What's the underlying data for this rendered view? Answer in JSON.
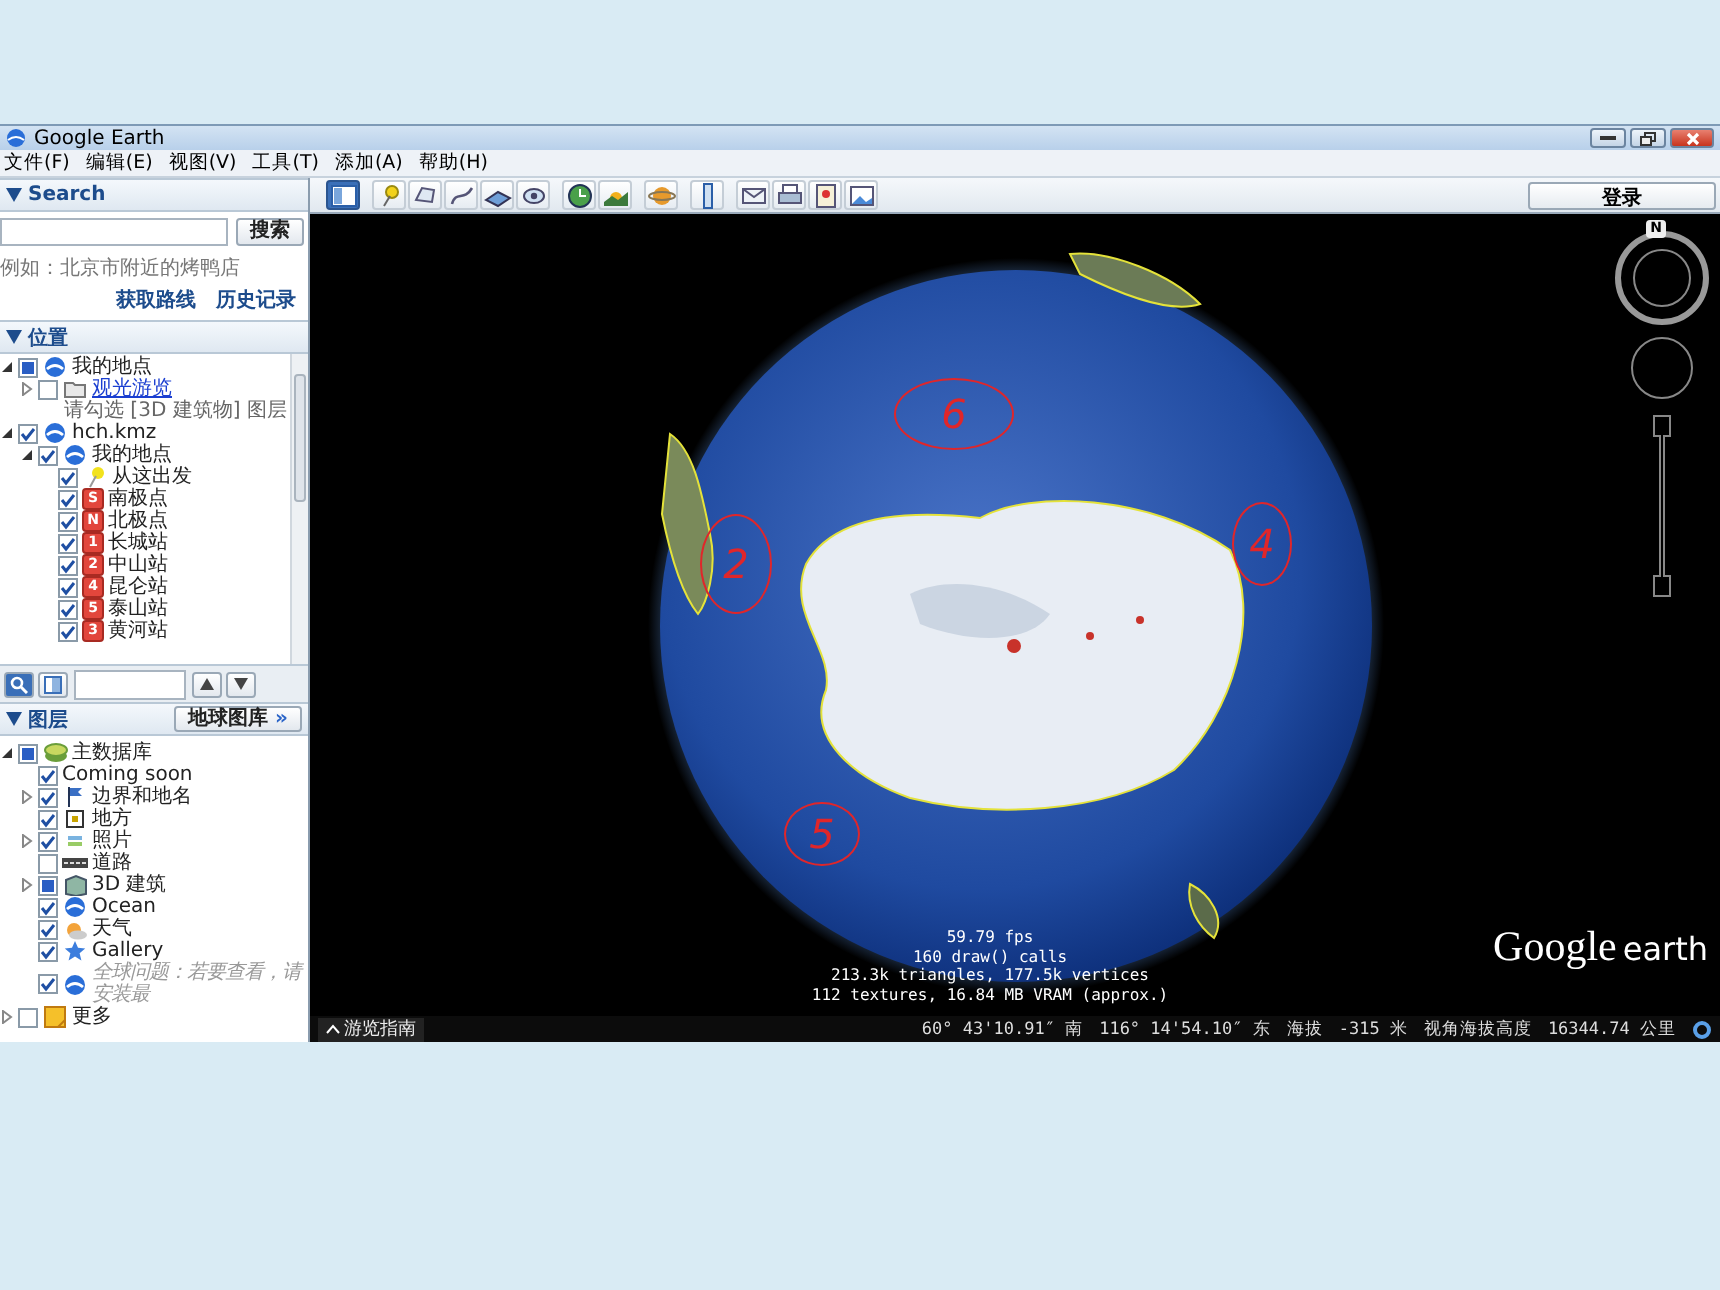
{
  "window": {
    "title": "Google Earth"
  },
  "menu": [
    {
      "label": "文件(F)"
    },
    {
      "label": "编辑(E)"
    },
    {
      "label": "视图(V)"
    },
    {
      "label": "工具(T)"
    },
    {
      "label": "添加(A)"
    },
    {
      "label": "帮助(H)"
    }
  ],
  "search": {
    "header": "Search",
    "expanded": true,
    "button": "搜索",
    "hint": "例如：北京市附近的烤鸭店",
    "links": [
      "获取路线",
      "历史记录"
    ]
  },
  "places": {
    "header": "位置",
    "expanded": true,
    "items": [
      {
        "label": "我的地点",
        "mixed": true,
        "kind": "globe",
        "expanded": true,
        "children": [
          {
            "label": "观光游览",
            "checked": false,
            "kind": "folder",
            "expanded": false,
            "link": true,
            "note": "请勾选 [3D 建筑物] 图层"
          }
        ]
      },
      {
        "label": "hch.kmz",
        "checked": true,
        "kind": "globe",
        "expanded": true,
        "children": [
          {
            "label": "我的地点",
            "checked": true,
            "kind": "globe",
            "expanded": true,
            "children": [
              {
                "label": "从这出发",
                "checked": true,
                "kind": "pin"
              },
              {
                "label": "南极点",
                "checked": true,
                "kind": "badge",
                "badge": "S"
              },
              {
                "label": "北极点",
                "checked": true,
                "kind": "badge",
                "badge": "N"
              },
              {
                "label": "长城站",
                "checked": true,
                "kind": "badge",
                "badge": "1"
              },
              {
                "label": "中山站",
                "checked": true,
                "kind": "badge",
                "badge": "2"
              },
              {
                "label": "昆仑站",
                "checked": true,
                "kind": "badge",
                "badge": "4"
              },
              {
                "label": "泰山站",
                "checked": true,
                "kind": "badge",
                "badge": "5"
              },
              {
                "label": "黄河站",
                "checked": true,
                "kind": "badge",
                "badge": "3"
              }
            ]
          }
        ]
      }
    ]
  },
  "layers": {
    "header": "图层",
    "expanded": true,
    "gallery_button": "地球图库",
    "gallery_arrow": "»",
    "items": [
      {
        "label": "主数据库",
        "mixed": true,
        "kind": "db",
        "expanded": true,
        "children": [
          {
            "label": "Coming soon",
            "checked": true,
            "kind": "plain"
          },
          {
            "label": "边界和地名",
            "checked": true,
            "kind": "flag",
            "expanded": false
          },
          {
            "label": "地方",
            "checked": true,
            "kind": "place"
          },
          {
            "label": "照片",
            "checked": true,
            "kind": "photo",
            "expanded": false
          },
          {
            "label": "道路",
            "checked": false,
            "kind": "road"
          },
          {
            "label": "3D 建筑",
            "mixed": true,
            "kind": "building",
            "expanded": false
          },
          {
            "label": "Ocean",
            "checked": true,
            "kind": "globe"
          },
          {
            "label": "天气",
            "checked": true,
            "kind": "weather"
          },
          {
            "label": "Gallery",
            "checked": true,
            "kind": "star"
          },
          {
            "label": "全球问题：若要查看，请安装最",
            "checked": true,
            "kind": "globe",
            "disabled": true
          }
        ]
      },
      {
        "label": "更多",
        "checked": false,
        "kind": "note",
        "expanded": false
      }
    ]
  },
  "toolbar": {
    "sign_in": "登录"
  },
  "viewer": {
    "compass": "N",
    "annotations": [
      "6",
      "2",
      "4",
      "5"
    ],
    "stats": [
      "59.79 fps",
      "160 draw() calls",
      "213.3k triangles, 177.5k vertices",
      "112 textures, 16.84 MB VRAM (approx.)"
    ],
    "logo": [
      "Google",
      "earth"
    ],
    "tour_guide": "游览指南",
    "status": [
      "60° 43'10.91″ 南",
      "116° 14'54.10″ 东",
      "海拔",
      "-315 米",
      "视角海拔高度",
      "16344.74 公里"
    ]
  }
}
